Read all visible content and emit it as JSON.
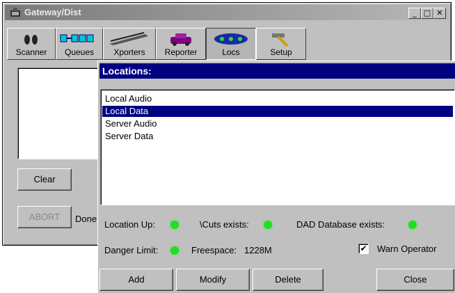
{
  "window": {
    "title": "Gateway/Dist",
    "controls": {
      "minimize": "_",
      "maximize": "□",
      "close": "✕"
    }
  },
  "toolbar": {
    "items": [
      {
        "label": "Scanner",
        "icon": "binoculars-icon"
      },
      {
        "label": "Queues",
        "icon": "queue-icon"
      },
      {
        "label": "Xporters",
        "icon": "transporter-icon"
      },
      {
        "label": "Reporter",
        "icon": "reporter-icon"
      },
      {
        "label": "Locs",
        "icon": "locations-icon",
        "active": true
      },
      {
        "label": "Setup",
        "icon": "hammer-icon"
      }
    ]
  },
  "left_panel": {
    "clear_label": "Clear",
    "abort_label": "ABORT",
    "status_text": "Done"
  },
  "locations_dialog": {
    "title": "Locations:",
    "items": [
      "Local Audio",
      "Local Data",
      "Server Audio",
      "Server Data"
    ],
    "selected_index": 1,
    "status": {
      "location_up": "Location Up:",
      "cuts_exists": "\\Cuts exists:",
      "dad_database_exists": "DAD Database exists:",
      "danger_limit": "Danger Limit:",
      "freespace_label": "Freespace:",
      "freespace_value": "1228M",
      "warn_operator_label": "Warn Operator",
      "warn_operator_checked": "✔",
      "led_color": "#22dd22"
    },
    "buttons": {
      "add": "Add",
      "modify": "Modify",
      "delete": "Delete",
      "close": "Close"
    }
  }
}
